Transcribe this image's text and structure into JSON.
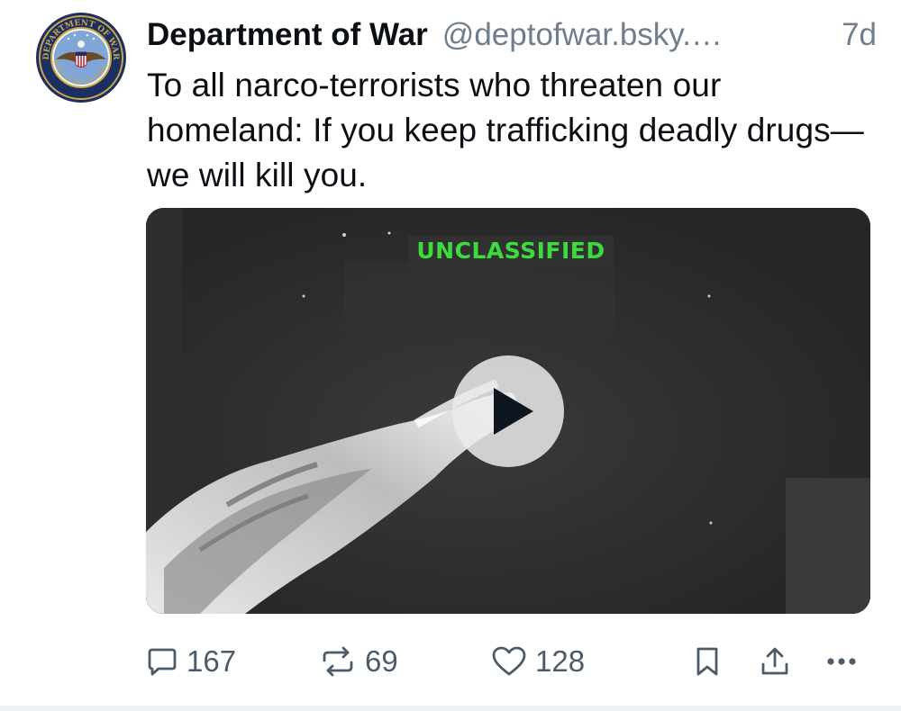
{
  "post": {
    "author": {
      "display_name": "Department of War",
      "handle": "@deptofwar.bsky.…",
      "avatar_icon": "department-of-war-seal",
      "avatar_text": "DEPARTMENT OF WAR · UNITED STATES OF AMERICA"
    },
    "timestamp": "7d",
    "text": "To all narco-terrorists who threaten our homeland: If you keep trafficking deadly drugs—we will kill you.",
    "video": {
      "overlay_label": "UNCLASSIFIED",
      "play_icon": "play-icon"
    },
    "actions": {
      "replies": "167",
      "reposts": "69",
      "likes": "128",
      "reply_icon": "comment-icon",
      "repost_icon": "repost-icon",
      "like_icon": "heart-icon",
      "bookmark_icon": "bookmark-icon",
      "share_icon": "share-icon",
      "more_icon": "more-icon"
    }
  },
  "colors": {
    "text": "#0b0f14",
    "muted": "#6f7e8c",
    "action": "#4c5b6a",
    "label_green": "#3bdc3b"
  }
}
